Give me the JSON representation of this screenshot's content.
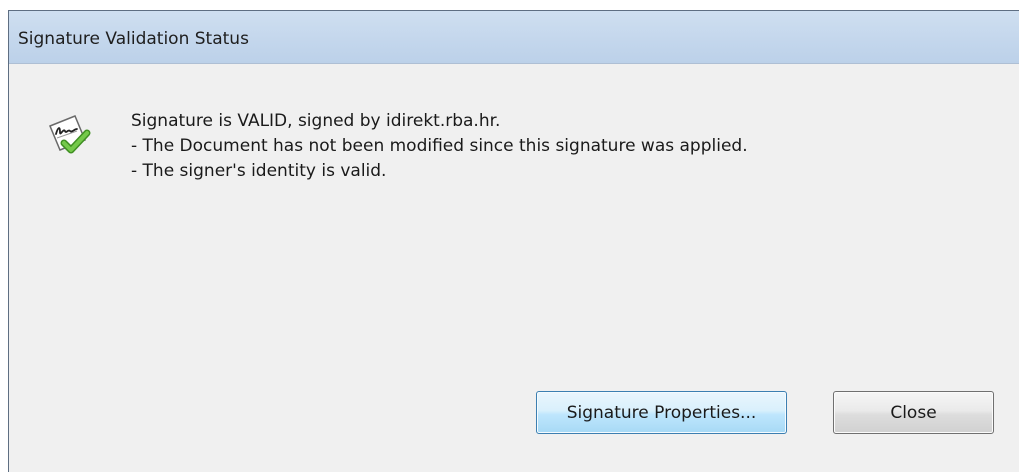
{
  "dialog": {
    "title": "Signature Validation Status",
    "icon": "signature-valid-icon",
    "messages": [
      "Signature is VALID, signed by idirekt.rba.hr.",
      "- The Document has not been modified since this signature was applied.",
      "- The signer's identity is valid."
    ]
  },
  "buttons": {
    "properties_label": "Signature Properties...",
    "close_label": "Close"
  },
  "colors": {
    "titlebar": "#c3d6ec",
    "body": "#f0f0f0",
    "check_green": "#5fb336"
  }
}
